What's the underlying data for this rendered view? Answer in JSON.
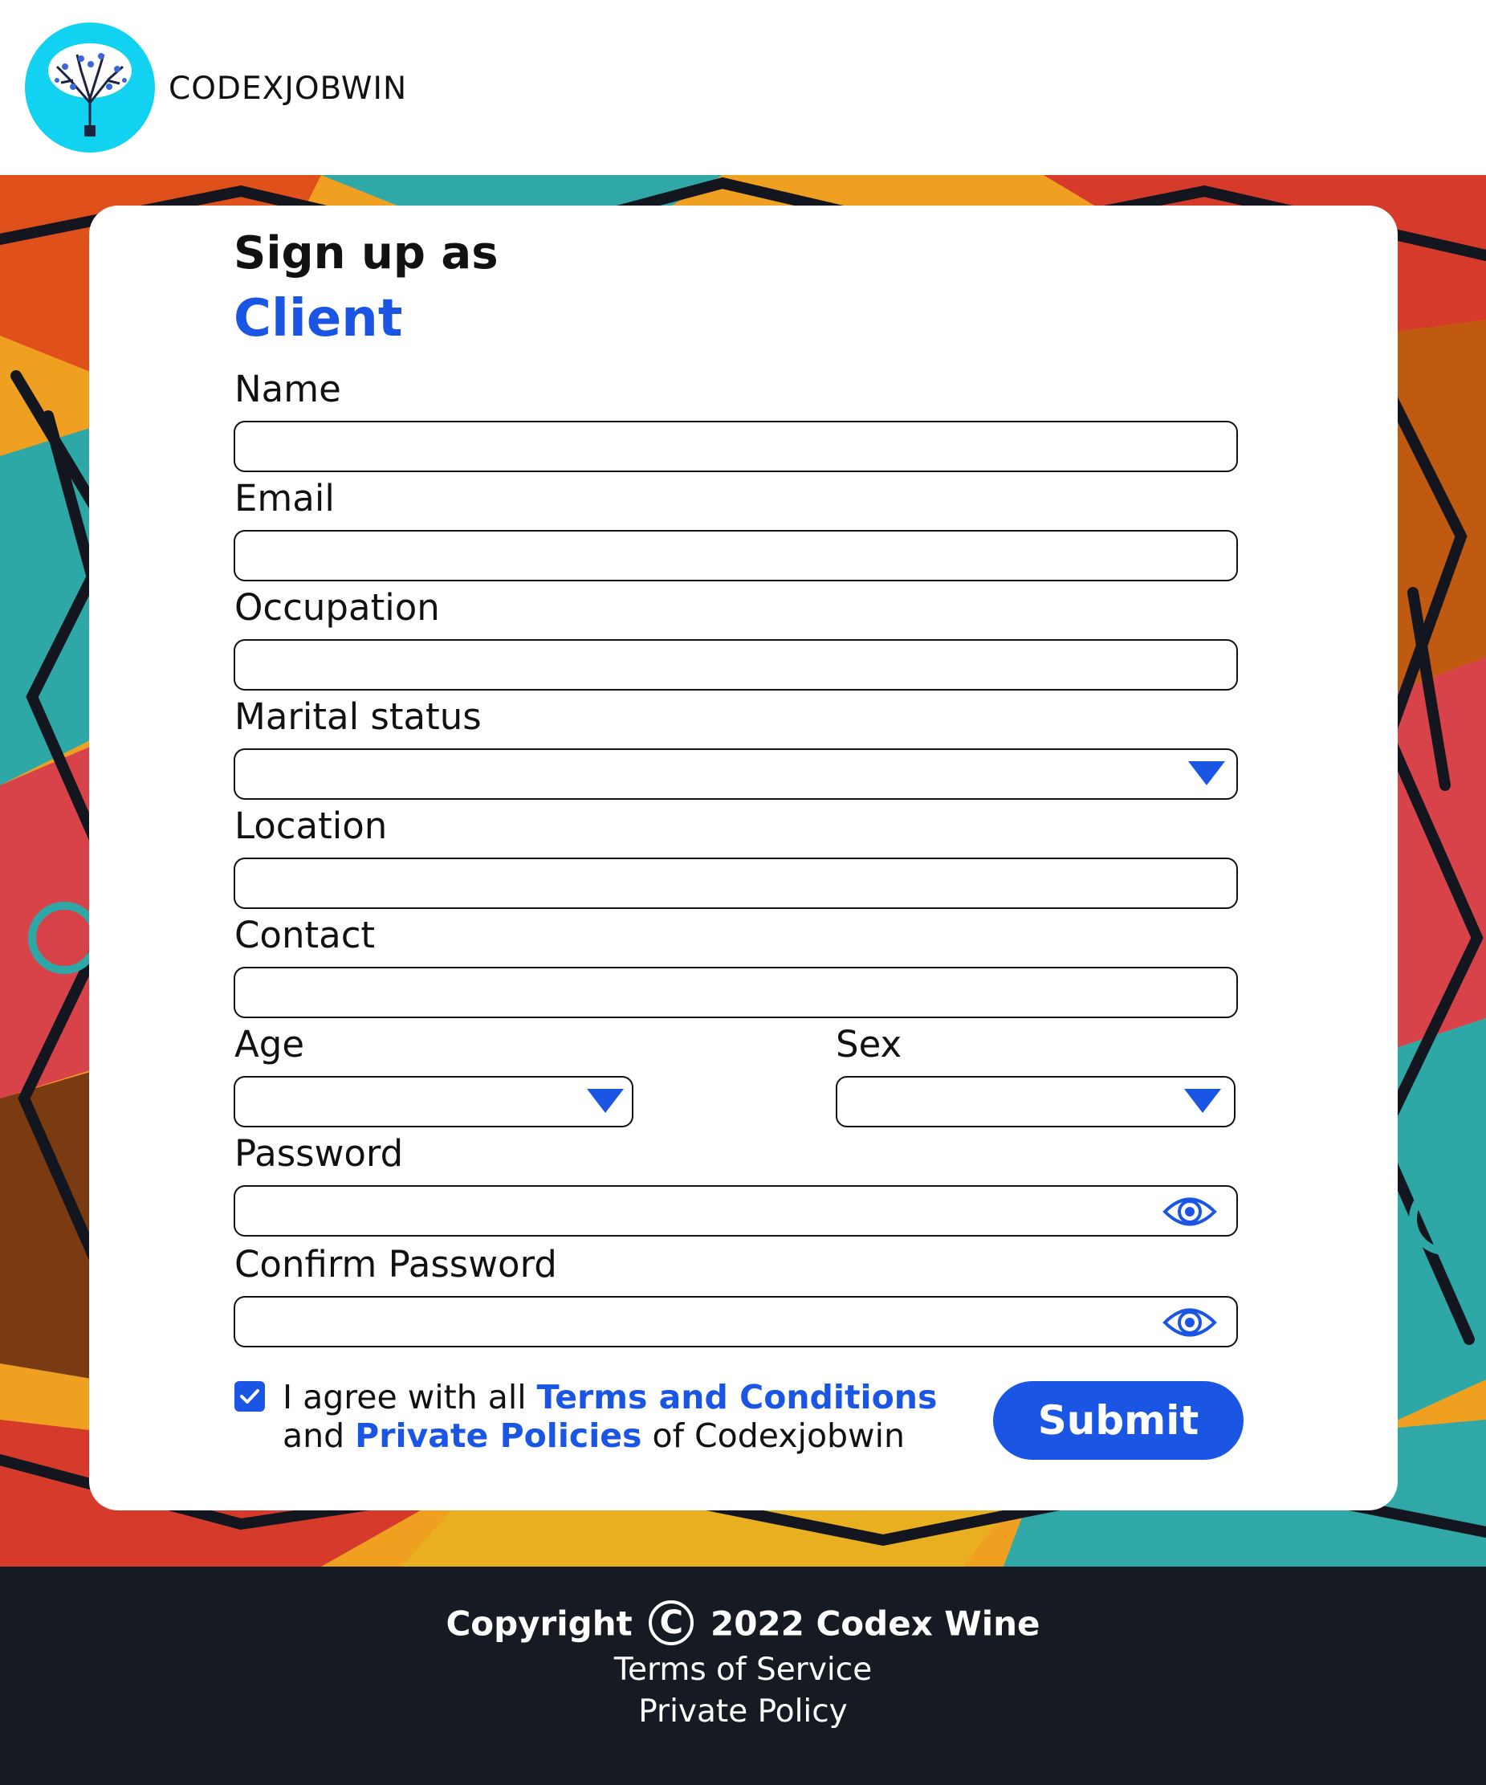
{
  "header": {
    "brand": "CODEXJOBWIN",
    "logo_icon": "tree-logo-icon"
  },
  "form": {
    "title": "Sign up as",
    "subtitle": "Client",
    "fields": {
      "name": {
        "label": "Name",
        "value": ""
      },
      "email": {
        "label": "Email",
        "value": ""
      },
      "occupation": {
        "label": "Occupation",
        "value": ""
      },
      "marital_status": {
        "label": "Marital status",
        "value": ""
      },
      "location": {
        "label": "Location",
        "value": ""
      },
      "contact": {
        "label": "Contact",
        "value": ""
      },
      "age": {
        "label": "Age",
        "value": ""
      },
      "sex": {
        "label": "Sex",
        "value": ""
      },
      "password": {
        "label": "Password",
        "value": ""
      },
      "confirm_password": {
        "label": "Confirm Password",
        "value": ""
      }
    },
    "agreement": {
      "checked": true,
      "text_1": "I agree with all ",
      "terms_link": "Terms and Conditions",
      "text_2": "and ",
      "policies_link": "Private Policies",
      "text_3": " of Codexjobwin"
    },
    "submit_label": "Submit"
  },
  "footer": {
    "copyright_prefix": "Copyright",
    "copyright_symbol": "C",
    "copyright_suffix": "2022 Codex Wine",
    "terms_link": "Terms of Service",
    "privacy_link": "Private Policy"
  },
  "colors": {
    "accent": "#1a55e3",
    "logo_bg": "#12d2f2",
    "footer_bg": "#161a23"
  }
}
